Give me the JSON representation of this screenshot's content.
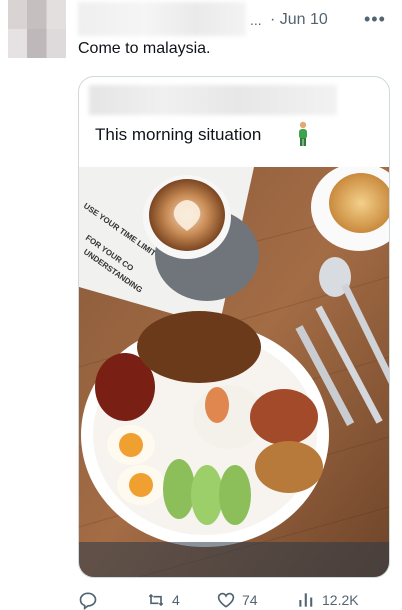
{
  "post": {
    "date": "· Jun 10",
    "truncation": "...",
    "more_icon": "more-horizontal-icon",
    "text": "Come to malaysia."
  },
  "quoted": {
    "caption": "This morning situation",
    "emoji": "person-standing-emoji",
    "menu_text": [
      "USE YOUR TIME LIMIT",
      "FOR YOUR CO",
      "UNDERSTANDING"
    ]
  },
  "actions": {
    "reply_icon": "reply-icon",
    "retweet_count": "4",
    "like_count": "74",
    "views_count": "12.2K"
  },
  "colors": {
    "muted": "#536471",
    "text": "#0f1419",
    "border": "#cfd9de"
  }
}
